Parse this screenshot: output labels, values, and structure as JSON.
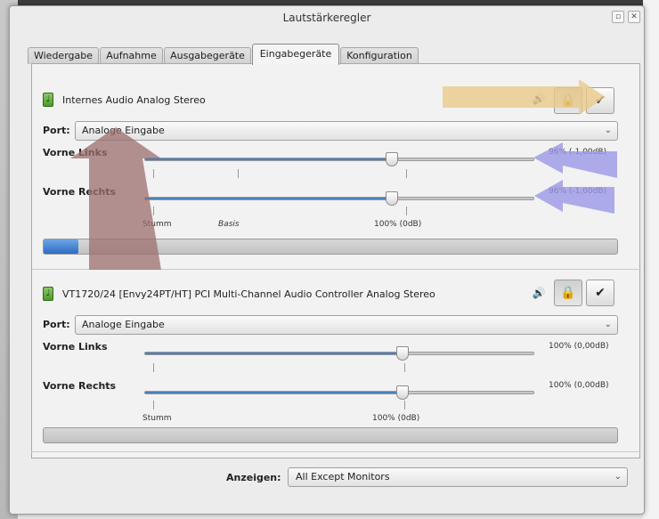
{
  "window": {
    "title": "Lautstärkeregler"
  },
  "tabs": [
    {
      "label": "Wiedergabe"
    },
    {
      "label": "Aufnahme"
    },
    {
      "label": "Ausgabegeräte"
    },
    {
      "label": "Eingabegeräte",
      "active": true
    },
    {
      "label": "Konfiguration"
    }
  ],
  "devices": [
    {
      "name": "Internes Audio Analog Stereo",
      "port_label": "Port:",
      "port_value": "Analoge Eingabe",
      "channels": [
        {
          "label": "Vorne Links",
          "value": "96% (-1,00dB)",
          "level": 0.96
        },
        {
          "label": "Vorne Rechts",
          "value": "96% (-1,00dB)",
          "level": 0.96
        }
      ],
      "marks": {
        "mute": "Stumm",
        "base": "Basis",
        "full": "100% (0dB)"
      },
      "meter_level": 0.06,
      "lock_pressed": true
    },
    {
      "name": "VT1720/24 [Envy24PT/HT] PCI Multi-Channel Audio Controller Analog Stereo",
      "port_label": "Port:",
      "port_value": "Analoge Eingabe",
      "channels": [
        {
          "label": "Vorne Links",
          "value": "100% (0,00dB)",
          "level": 1.0
        },
        {
          "label": "Vorne Rechts",
          "value": "100% (0,00dB)",
          "level": 1.0
        }
      ],
      "marks": {
        "mute": "Stumm",
        "full": "100% (0dB)"
      },
      "meter_level": 0.0,
      "lock_pressed": true
    }
  ],
  "footer": {
    "show_label": "Anzeigen:",
    "show_value": "All Except Monitors"
  },
  "icons": {
    "device": "microphone-icon",
    "speaker": "speaker-icon",
    "lock": "lock-icon",
    "check": "checkmark-icon",
    "dropdown": "chevron-down-icon"
  },
  "colors": {
    "accent": "#4a7fc0",
    "arrow_yellow": "#e8c98a",
    "arrow_purple": "#9b97e6",
    "arrow_red": "#9c6e6e"
  }
}
